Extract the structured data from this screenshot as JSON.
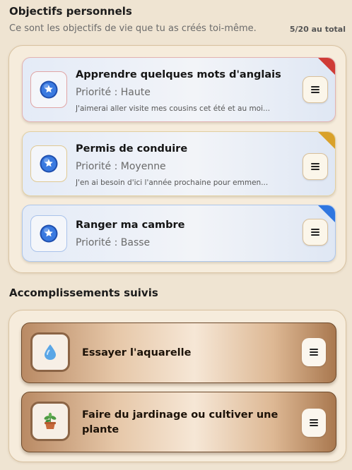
{
  "objectives": {
    "title": "Objectifs personnels",
    "subtitle": "Ce sont les objectifs de vie que tu as créés toi-même.",
    "counter": "5/20 au total",
    "goals": [
      {
        "title": "Apprendre quelques mots d'anglais",
        "priority": "Priorité : Haute",
        "description": "J'aimerai aller visite mes cousins cet été et au moi...",
        "color": "#cf3b36",
        "icon": "star-badge-icon"
      },
      {
        "title": "Permis de conduire",
        "priority": "Priorité : Moyenne",
        "description": "J'en ai besoin d'ici l'année prochaine pour emmen...",
        "color": "#d9a12a",
        "icon": "star-badge-icon"
      },
      {
        "title": "Ranger ma cambre",
        "priority": "Priorité : Basse",
        "description": "",
        "color": "#2f76e0",
        "icon": "star-badge-icon"
      }
    ]
  },
  "achievements": {
    "title": "Accomplissements suivis",
    "items": [
      {
        "title": "Essayer l'aquarelle",
        "icon": "water-drop-icon"
      },
      {
        "title": "Faire du jardinage ou cultiver une plante",
        "icon": "potted-plant-icon"
      }
    ]
  },
  "colors": {
    "background": "#efe4d2",
    "panel": "#f6ecdc",
    "priority_high": "#cf3b36",
    "priority_medium": "#d9a12a",
    "priority_low": "#2f76e0"
  }
}
